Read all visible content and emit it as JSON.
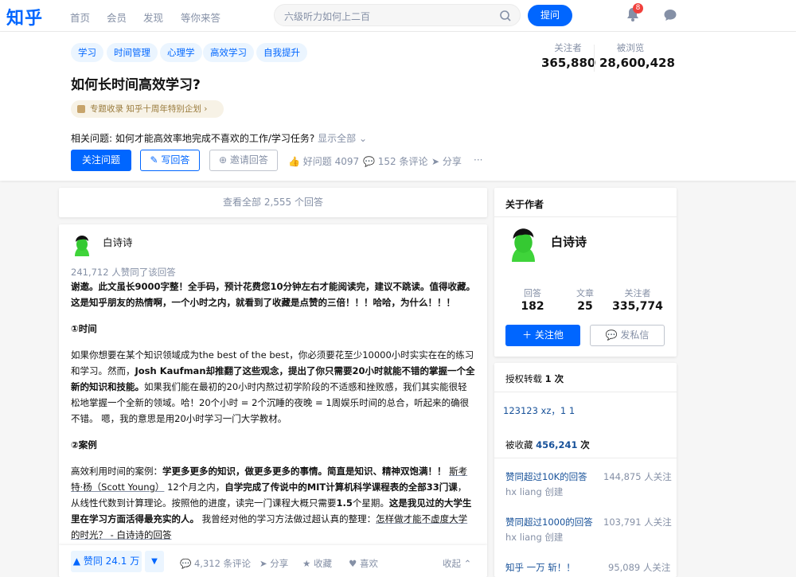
{
  "topbar": {
    "logo": "知乎",
    "nav": [
      "首页",
      "会员",
      "发现",
      "等你来答"
    ],
    "search_placeholder": "六级听力如何上二百",
    "ask_label": "提问",
    "notification_count": "8"
  },
  "question": {
    "tags": [
      "学习",
      "时间管理",
      "心理学",
      "高效学习",
      "自我提升"
    ],
    "title": "如何长时间高效学习?",
    "special": "专题收录 知乎十周年特别企划",
    "related_label": "相关问题:",
    "related_link": "如何才能高效率地完成不喜欢的工作/学习任务?",
    "related_more": "显示全部",
    "follow_label": "关注问题",
    "write_label": "写回答",
    "invite_label": "邀请回答",
    "good_question": "好问题 4097",
    "comments": "152 条评论",
    "share": "分享",
    "more": "···",
    "followers_label": "关注者",
    "followers": "365,880",
    "views_label": "被浏览",
    "views": "28,600,428"
  },
  "view_all": "查看全部 2,555 个回答",
  "answer": {
    "author": "白诗诗",
    "votes_text": "241,712 人赞同了该回答",
    "p1": "谢邀。此文虽长9000字整！全手码，预计花费您10分钟左右才能阅读完，建议不跳读。值得收藏。这是知乎朋友的热情啊，一个小时之内，就看到了收藏是点赞的三倍！！！哈哈，为什么！！！",
    "h1": "①时间",
    "p2a": "如果你想要在某个知识领域成为the best of the best，你必须要花至少10000小时实实在在的练习和学习。然而，",
    "p2b": "Josh Kaufman却推翻了这些观念，提出了你只需要20小时就能不错的掌握一个全新的知识和技能。",
    "p2c": "如果我们能在最初的20小时内熬过初学阶段的不适感和挫败感，我们其实能很轻松地掌握一个全新的领域。哈！20个小时 = 2个沉睡的夜晚 = 1周娱乐时间的总合，听起来的确很不错。 嗯，我的意思是用20小时学习一门大学教材。",
    "h2": "②案例",
    "p3a": "高效利用时间的案例：",
    "p3b": "学更多更多的知识，做更多更多的事情。简直是知识、精神双饱满！！",
    "p3c": "斯考特·杨（Scott Young）",
    "p3d": "12个月之内，",
    "p3e": "自学完成了传说中的MIT计算机科学课程表的全部33门课",
    "p3f": "，从线性代数到计算理论。按照他的进度，读完一门课程大概只需要",
    "p3g": "1.5",
    "p3h": "个星期。",
    "p3i": "这是我见过的大学生里在学习方面活得最充实的人。",
    "p3j": " 我曾经对他的学习方法做过超认真的整理：",
    "p3k": "怎样做才能不虚度大学的时光？ - 白诗诗的回答",
    "vote_label": "▲ 赞同 24.1 万",
    "vote_down": "▼",
    "comments": "4,312 条评论",
    "share": "分享",
    "collect": "收藏",
    "like": "喜欢",
    "collapse": "收起"
  },
  "author_card": {
    "heading": "关于作者",
    "name": "白诗诗",
    "answers_label": "回答",
    "answers": "182",
    "articles_label": "文章",
    "articles": "25",
    "followers_label": "关注者",
    "followers": "335,774",
    "follow_label": "关注他",
    "message_label": "发私信"
  },
  "side2": {
    "repost_label": "授权转载",
    "repost_count": "1 次",
    "repost_user": "123123 xz，1 1",
    "collected_label": "被收藏",
    "collected_count": "456,241",
    "collected_unit": "次",
    "collections": [
      {
        "title": "赞同超过10K的回答",
        "creator": "hx liang 创建",
        "count": "144,875 人关注"
      },
      {
        "title": "赞同超过1000的回答",
        "creator": "hx liang 创建",
        "count": "103,791 人关注"
      },
      {
        "title": "知乎 一万 斩！！",
        "creator": "",
        "count": "95,089 人关注"
      }
    ]
  },
  "colors": {
    "brand": "#0066ff",
    "text": "#121212",
    "gray": "#8590a6",
    "bg": "#f6f6f6"
  }
}
